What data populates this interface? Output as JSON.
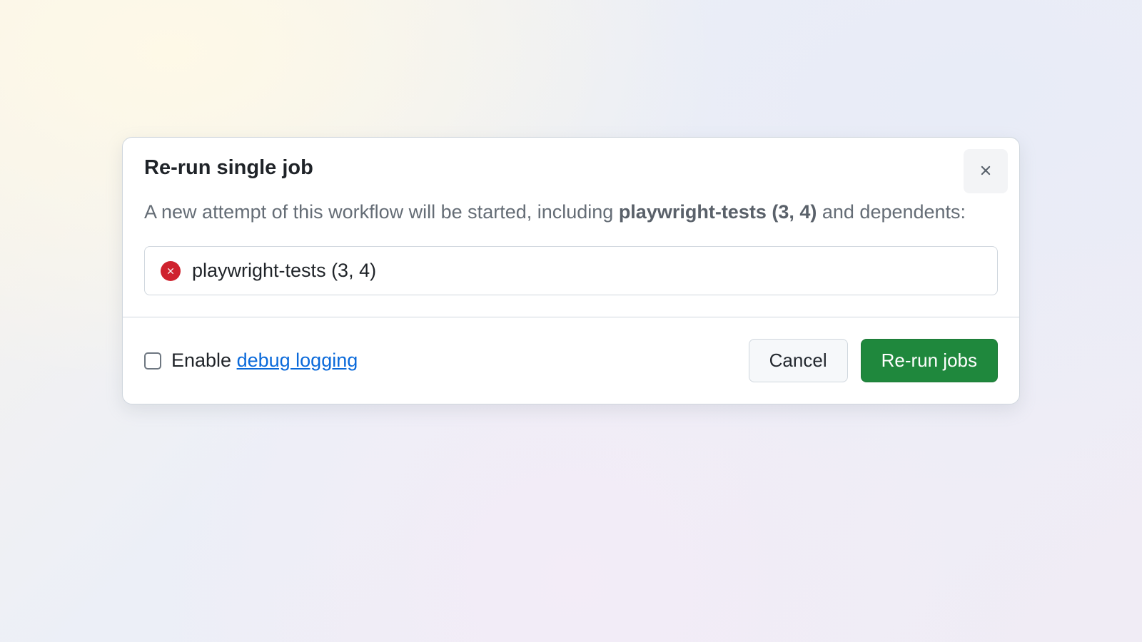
{
  "dialog": {
    "title": "Re-run single job",
    "description_prefix": "A new attempt of this workflow will be started, including ",
    "description_bold": "playwright-tests (3, 4)",
    "description_suffix": " and dependents:",
    "job": {
      "name": "playwright-tests (3, 4)",
      "status": "failed"
    },
    "checkbox": {
      "label_prefix": "Enable ",
      "link_text": "debug logging",
      "checked": false
    },
    "buttons": {
      "cancel": "Cancel",
      "confirm": "Re-run jobs"
    }
  },
  "colors": {
    "danger": "#cf222e",
    "primary": "#1f883d",
    "link": "#0969da"
  }
}
